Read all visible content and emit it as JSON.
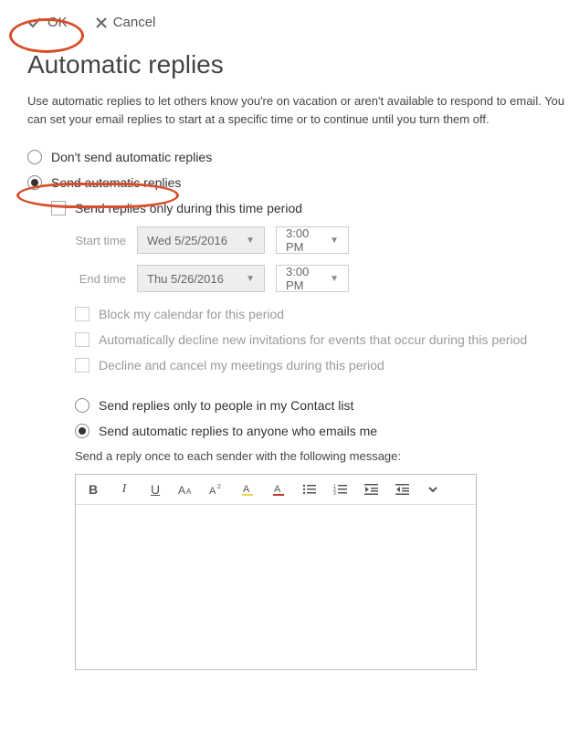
{
  "toolbar": {
    "ok_label": "OK",
    "cancel_label": "Cancel"
  },
  "page": {
    "title": "Automatic replies",
    "description": "Use automatic replies to let others know you're on vacation or aren't available to respond to email. You can set your email replies to start at a specific time or to continue until you turn them off."
  },
  "options": {
    "dont_send_label": "Don't send automatic replies",
    "send_label": "Send automatic replies",
    "send_selected": true,
    "only_period_label": "Send replies only during this time period",
    "only_period_checked": false,
    "start_label": "Start time",
    "end_label": "End time",
    "start_date": "Wed 5/25/2016",
    "start_time": "3:00 PM",
    "end_date": "Thu 5/26/2016",
    "end_time": "3:00 PM",
    "block_calendar_label": "Block my calendar for this period",
    "decline_new_label": "Automatically decline new invitations for events that occur during this period",
    "decline_cancel_label": "Decline and cancel my meetings during this period",
    "contacts_only_label": "Send replies only to people in my Contact list",
    "anyone_label": "Send automatic replies to anyone who emails me",
    "reply_once_label": "Send a reply once to each sender with the following message:"
  },
  "editor": {
    "content": ""
  }
}
